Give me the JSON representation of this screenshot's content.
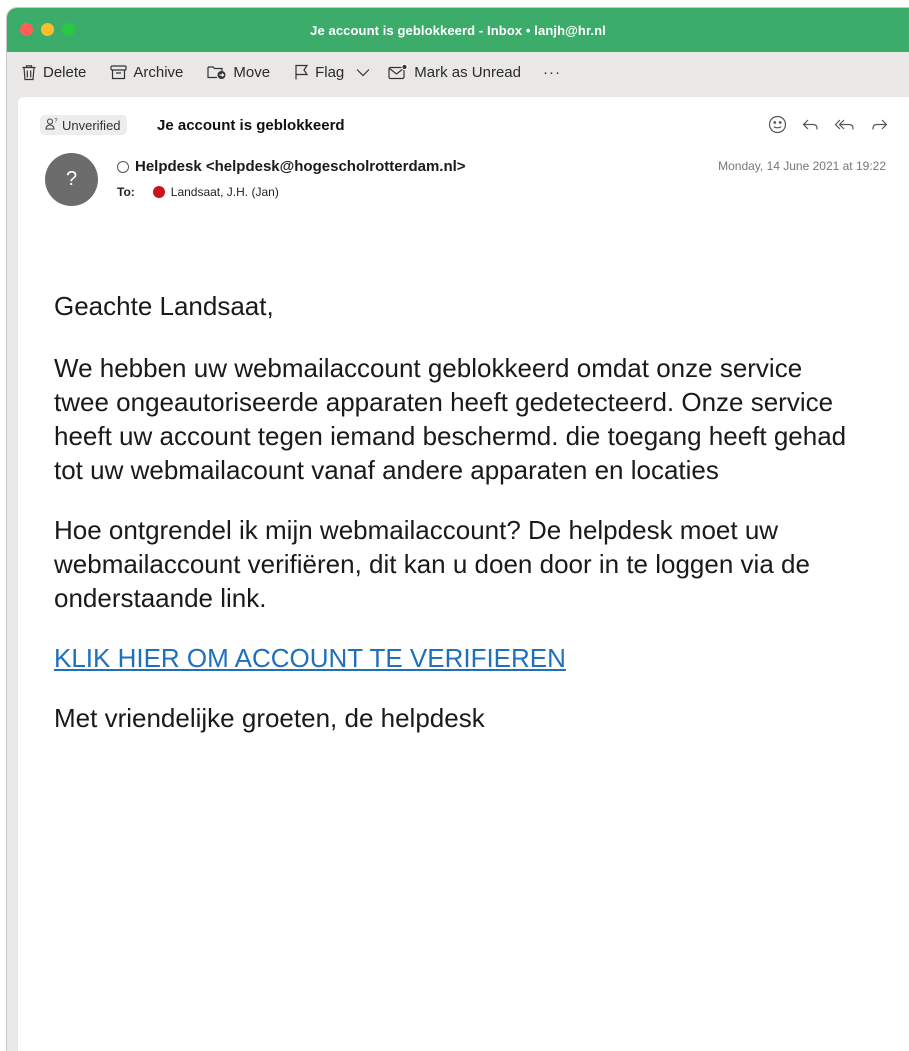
{
  "window": {
    "title": "Je account is geblokkeerd - Inbox • lanjh@hr.nl"
  },
  "toolbar": {
    "delete": "Delete",
    "archive": "Archive",
    "move": "Move",
    "flag": "Flag",
    "mark_unread": "Mark as Unread",
    "more": "···"
  },
  "message": {
    "badge": "Unverified",
    "subject": "Je account is geblokkeerd",
    "avatar": "?",
    "from": "Helpdesk <helpdesk@hogescholrotterdam.nl>",
    "to_label": "To:",
    "to_name": "Landsaat, J.H. (Jan)",
    "date": "Monday, 14 June 2021 at 19:22"
  },
  "body": {
    "greeting": "Geachte Landsaat,",
    "paragraph1": "We hebben uw webmailaccount geblokkeerd omdat onze service twee ongeautoriseerde apparaten heeft gedetecteerd. Onze service heeft uw account tegen iemand beschermd. die toegang heeft gehad tot uw webmailacount vanaf andere apparaten en locaties",
    "paragraph2": "Hoe ontgrendel ik mijn webmailaccount? De helpdesk moet uw webmailaccount verifiëren, dit kan u doen door in te loggen via de onderstaande link.",
    "link": "KLIK HIER OM ACCOUNT TE VERIFIEREN",
    "closing": "Met vriendelijke groeten, de helpdesk"
  },
  "colors": {
    "titlebar": "#3cac6b",
    "link": "#1f6fbf",
    "recipient_dot": "#c8151b"
  }
}
